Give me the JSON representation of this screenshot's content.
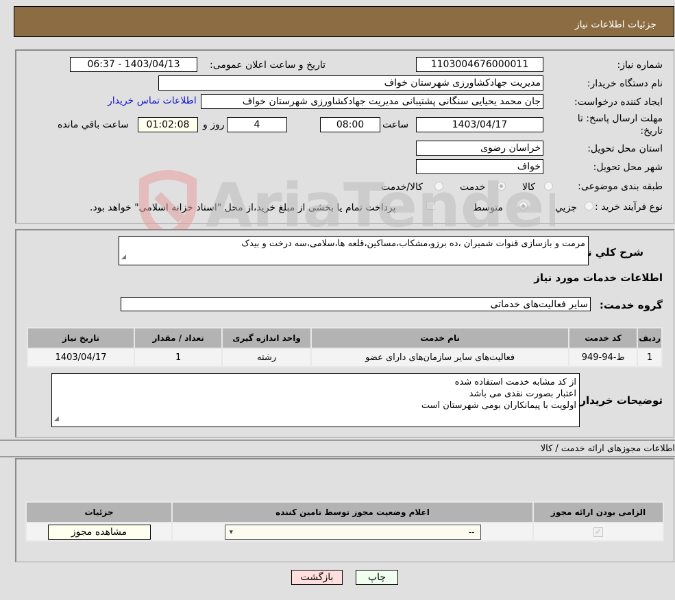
{
  "header": {
    "title": "جزئیات اطلاعات نیاز"
  },
  "form": {
    "need_number_label": "شماره نیاز:",
    "need_number": "1103004676000011",
    "announce_label": "تاریخ و ساعت اعلان عمومی:",
    "announce_value": "1403/04/13 - 06:37",
    "buyer_org_label": "نام دستگاه خریدار:",
    "buyer_org": "مدیریت جهادکشاورزی شهرستان خواف",
    "requester_label": "ایجاد کننده درخواست:",
    "requester": "جان محمد یحیایی سنگانی پشتیبانی مدیریت جهادکشاورزی شهرستان خواف",
    "buyer_contact_link": "اطلاعات تماس خریدار",
    "deadline_label_1": "مهلت ارسال پاسخ: تا",
    "deadline_label_2": "تاریخ:",
    "deadline_date": "1403/04/17",
    "time_label": "ساعت",
    "deadline_time": "08:00",
    "days_value": "4",
    "days_label": "روز و",
    "remaining_time": "01:02:08",
    "remaining_label": "ساعت باقي مانده",
    "province_label": "استان محل تحویل:",
    "province": "خراسان رضوی",
    "city_label": "شهر محل تحویل:",
    "city": "خواف",
    "category_label": "طبقه بندی موضوعی:",
    "category_options": [
      "کالا",
      "خدمت",
      "کالا/خدمت"
    ],
    "category_selected": "خدمت",
    "process_label": "نوع فرآیند خرید :",
    "process_options": [
      "جزيي",
      "متوسط"
    ],
    "process_selected": "متوسط",
    "treasury_text": "پرداخت تمام یا بخشی از مبلغ خرید،از محل \"اسناد خزانه اسلامی\" خواهد بود."
  },
  "details": {
    "summary_label": "شرح کلي نياز:",
    "summary": "مرمت و بازسازی قنوات شمیران ،ده برزو،مشکاب،مساکین،قلعه ها،سلامی،سه درخت و بیدک",
    "services_title": "اطلاعات خدمات مورد نیاز",
    "service_group_label": "گروه خدمت:",
    "service_group": "سایر فعالیت‌های خدماتی",
    "table": {
      "headers": [
        "ردیف",
        "کد خدمت",
        "نام خدمت",
        "واحد اندازه گیری",
        "تعداد / مقدار",
        "تاریخ نیاز"
      ],
      "rows": [
        [
          "1",
          "ط-94-949",
          "فعالیت‌های سایر سازمان‌های دارای عضو",
          "رشته",
          "1",
          "1403/04/17"
        ]
      ]
    },
    "buyer_notes_label": "توضیحات خریدار:",
    "buyer_notes": [
      "از کد مشابه خدمت استفاده شده",
      "اعتبار بصورت نقدی می باشد",
      "اولویت با پیمانکاران بومی شهرستان است"
    ]
  },
  "permits": {
    "section_title": "اطلاعات مجوزهای ارائه خدمت / کالا",
    "headers": [
      "الزامی بودن ارائه مجوز",
      "اعلام وضعیت مجوز توسط تامین کننده",
      "جزئیات"
    ],
    "row": {
      "required_checked": true,
      "status_value": "--",
      "view_button": "مشاهده مجوز"
    }
  },
  "buttons": {
    "print": "چاپ",
    "back": "بازگشت"
  },
  "watermark": {
    "text": "AriaTender.neT"
  }
}
